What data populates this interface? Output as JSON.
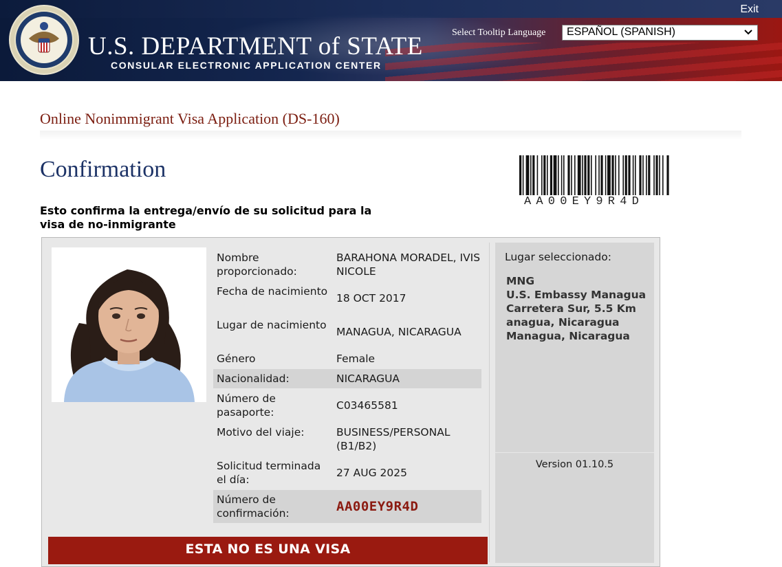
{
  "header": {
    "exit_label": "Exit",
    "department_title": "U.S. DEPARTMENT of STATE",
    "department_subtitle": "CONSULAR ELECTRONIC APPLICATION CENTER",
    "tooltip_language_label": "Select Tooltip Language",
    "tooltip_language_value": "ESPAÑOL (SPANISH)"
  },
  "page": {
    "application_title": "Online Nonimmigrant Visa Application (DS-160)",
    "confirmation_title": "Confirmation",
    "barcode_text": "AA00EY9R4D",
    "intro_text": "Esto confirma la entrega/envío de su solicitud para la visa de no-inmigrante"
  },
  "applicant": {
    "fields": [
      {
        "label": "Nombre proporcionado:",
        "value": "BARAHONA MORADEL, IVIS NICOLE"
      },
      {
        "label": "Fecha de nacimiento",
        "value": "18 OCT 2017"
      },
      {
        "label": "Lugar de nacimiento",
        "value": "MANAGUA, NICARAGUA"
      },
      {
        "label": "Género",
        "value": "Female"
      },
      {
        "label": "Nacionalidad:",
        "value": "NICARAGUA"
      },
      {
        "label": "Número de pasaporte:",
        "value": "C03465581"
      },
      {
        "label": "Motivo del viaje:",
        "value": "BUSINESS/PERSONAL (B1/B2)"
      },
      {
        "label": "Solicitud terminada el día:",
        "value": "27 AUG 2025"
      },
      {
        "label": "Número de confirmación:",
        "value": "AA00EY9R4D"
      }
    ]
  },
  "location": {
    "header": "Lugar seleccionado:",
    "lines": [
      "MNG",
      "U.S. Embassy Managua",
      "Carretera Sur, 5.5 Km",
      "anagua, Nicaragua",
      "Managua, Nicaragua"
    ]
  },
  "version_text": "Version 01.10.5",
  "notice_text": "ESTA NO ES UNA VISA",
  "colors": {
    "brand_red": "#7b1d10",
    "title_blue": "#1c3266",
    "notice_red": "#9a1a10"
  }
}
